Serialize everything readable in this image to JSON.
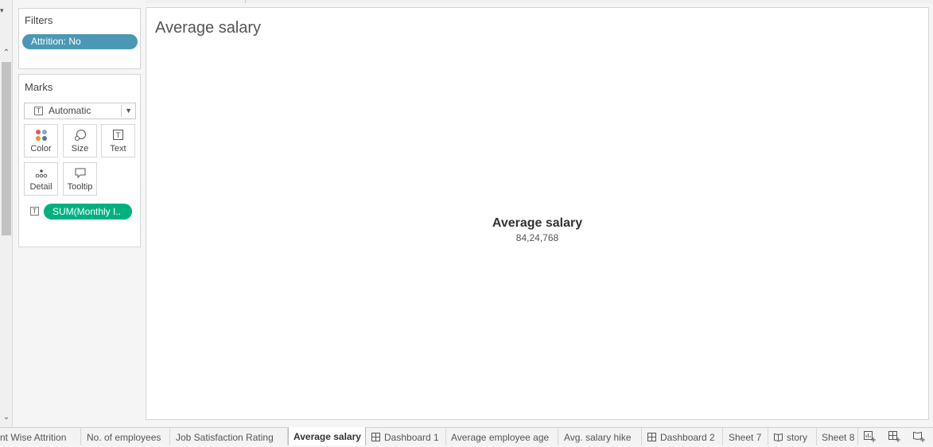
{
  "filters": {
    "title": "Filters",
    "pills": [
      "Attrition: No"
    ]
  },
  "marks": {
    "title": "Marks",
    "mark_type": "Automatic",
    "buttons": [
      "Color",
      "Size",
      "Text",
      "Detail",
      "Tooltip"
    ],
    "pill": "SUM(Monthly I..",
    "pill_color": "#00b180"
  },
  "filter_pill_color": "#4b97b5",
  "view": {
    "title": "Average salary",
    "kpi_label": "Average salary",
    "kpi_value": "84,24,768"
  },
  "tabs": [
    {
      "label": "nt Wise Attrition",
      "icon": ""
    },
    {
      "label": "No. of employees",
      "icon": ""
    },
    {
      "label": "Job Satisfaction Rating",
      "icon": ""
    },
    {
      "label": "Average salary",
      "icon": "",
      "active": true
    },
    {
      "label": "Dashboard 1",
      "icon": "dashboard-icon"
    },
    {
      "label": "Average employee age",
      "icon": ""
    },
    {
      "label": "Avg. salary hike",
      "icon": ""
    },
    {
      "label": "Dashboard 2",
      "icon": "dashboard-icon"
    },
    {
      "label": "Sheet 7",
      "icon": ""
    },
    {
      "label": "story",
      "icon": "story-icon"
    },
    {
      "label": "Sheet 8",
      "icon": ""
    }
  ],
  "new_buttons": [
    "new-worksheet-icon",
    "new-dashboard-icon",
    "new-story-icon"
  ]
}
